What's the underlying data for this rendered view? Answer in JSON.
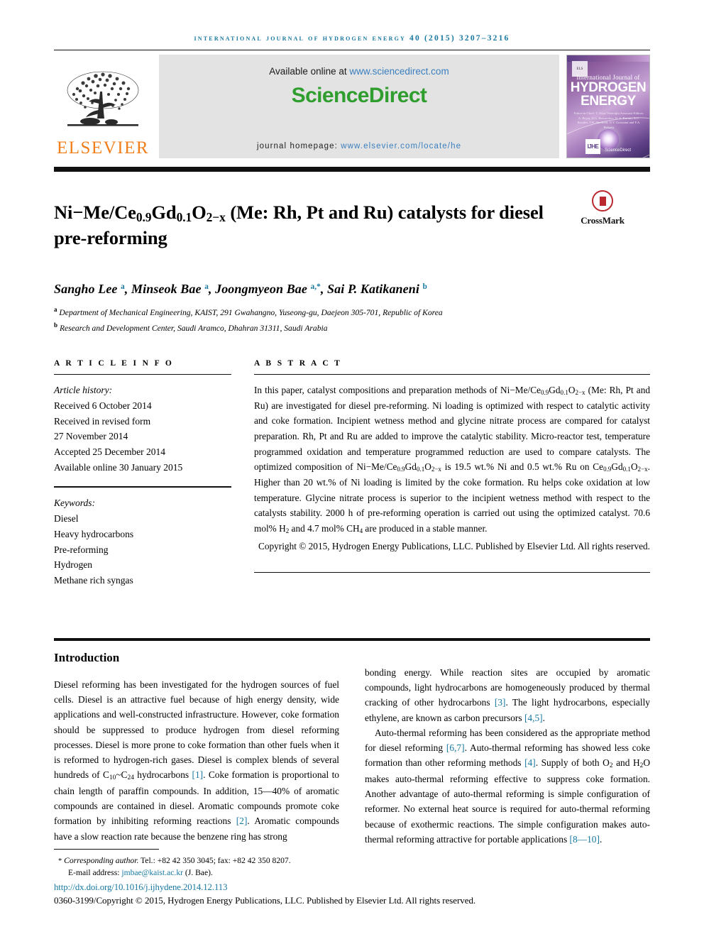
{
  "running_head": "International Journal of Hydrogen Energy 40 (2015) 3207–3216",
  "masthead": {
    "publisher": "ELSEVIER",
    "available_prefix": "Available online at ",
    "available_url": "www.sciencedirect.com",
    "sciencedirect_science": "Science",
    "sciencedirect_direct": "Direct",
    "homepage_prefix": "journal homepage: ",
    "homepage_url": "www.elsevier.com/locate/he",
    "cover": {
      "elsevier_mark": "ELSEVIER",
      "subtitle": "International Journal of",
      "title_line1": "HYDROGEN",
      "title_line2": "ENERGY",
      "editors": "Editor-in-Chief: T. Nejat Veziroğlu\nAssociate Editors: A. Bejan, D.G. Bessarabov, N. A. Kurum, A.C. Rosales, J.W. Sheffield, D.Y. Goswami and F.A. Peñuela",
      "ijhe_mark": "IJHE",
      "sciencedirect_mark": "ScienceDirect"
    }
  },
  "article": {
    "title_html": "Ni−Me/Ce<sub>0.9</sub>Gd<sub>0.1</sub>O<sub>2−x</sub> (Me: Rh, Pt and Ru) catalysts for diesel pre-reforming",
    "crossmark_label": "CrossMark",
    "authors_html": "Sangho Lee <sup>a</sup>, Minseok Bae <sup>a</sup>, Joongmyeon Bae <sup>a,*</sup>, Sai P. Katikaneni <sup>b</sup>",
    "affiliations": [
      {
        "marker": "a",
        "text": "Department of Mechanical Engineering, KAIST, 291 Gwahangno, Yuseong-gu, Daejeon 305-701, Republic of Korea"
      },
      {
        "marker": "b",
        "text": "Research and Development Center, Saudi Aramco, Dhahran 31311, Saudi Arabia"
      }
    ]
  },
  "article_info": {
    "heading": "A R T I C L E   I N F O",
    "history_label": "Article history:",
    "history": [
      "Received 6 October 2014",
      "Received in revised form",
      "27 November 2014",
      "Accepted 25 December 2014",
      "Available online 30 January 2015"
    ],
    "keywords_label": "Keywords:",
    "keywords": [
      "Diesel",
      "Heavy hydrocarbons",
      "Pre-reforming",
      "Hydrogen",
      "Methane rich syngas"
    ]
  },
  "abstract": {
    "heading": "A B S T R A C T",
    "body_html": "In this paper, catalyst compositions and preparation methods of Ni−Me/Ce<sub>0.9</sub>Gd<sub>0.1</sub>O<sub>2−x</sub> (Me: Rh, Pt and Ru) are investigated for diesel pre-reforming. Ni loading is optimized with respect to catalytic activity and coke formation. Incipient wetness method and glycine nitrate process are compared for catalyst preparation. Rh, Pt and Ru are added to improve the catalytic stability. Micro-reactor test, temperature programmed oxidation and temperature programmed reduction are used to compare catalysts. The optimized composition of Ni−Me/Ce<sub>0.9</sub>Gd<sub>0.1</sub>O<sub>2−x</sub> is 19.5 wt.% Ni and 0.5 wt.% Ru on Ce<sub>0.9</sub>Gd<sub>0.1</sub>O<sub>2−x</sub>. Higher than 20 wt.% of Ni loading is limited by the coke formation. Ru helps coke oxidation at low temperature. Glycine nitrate process is superior to the incipient wetness method with respect to the catalysts stability. 2000 h of pre-reforming operation is carried out using the optimized catalyst. 70.6 mol% H<sub>2</sub> and 4.7 mol% CH<sub>4</sub> are produced in a stable manner.",
    "copyright": "Copyright © 2015, Hydrogen Energy Publications, LLC. Published by Elsevier Ltd. All rights reserved."
  },
  "introduction": {
    "heading": "Introduction",
    "left_paragraph_html": "Diesel reforming has been investigated for the hydrogen sources of fuel cells. Diesel is an attractive fuel because of high energy density, wide applications and well-constructed infrastructure. However, coke formation should be suppressed to produce hydrogen from diesel reforming processes. Diesel is more prone to coke formation than other fuels when it is reformed to hydrogen-rich gases. Diesel is complex blends of several hundreds of C<sub>10</sub>~C<sub>24</sub> hydrocarbons <span class=\"cite\">[1]</span>. Coke formation is proportional to chain length of paraffin compounds. In addition, 15—40% of aromatic compounds are contained in diesel. Aromatic compounds promote coke formation by inhibiting reforming reactions <span class=\"cite\">[2]</span>. Aromatic compounds have a slow reaction rate because the benzene ring has strong",
    "right_paragraph_1_html": "bonding energy. While reaction sites are occupied by aromatic compounds, light hydrocarbons are homogeneously produced by thermal cracking of other hydrocarbons <span class=\"cite\">[3]</span>. The light hydrocarbons, especially ethylene, are known as carbon precursors <span class=\"cite\">[4,5]</span>.",
    "right_paragraph_2_html": "Auto-thermal reforming has been considered as the appropriate method for diesel reforming <span class=\"cite\">[6,7]</span>. Auto-thermal reforming has showed less coke formation than other reforming methods <span class=\"cite\">[4]</span>. Supply of both O<sub>2</sub> and H<sub>2</sub>O makes auto-thermal reforming effective to suppress coke formation. Another advantage of auto-thermal reforming is simple configuration of reformer. No external heat source is required for auto-thermal reforming because of exothermic reactions. The simple configuration makes auto-thermal reforming attractive for portable applications <span class=\"cite\">[8—10]</span>."
  },
  "footer": {
    "corresponding_html": "<span class=\"star\">*</span> <i>Corresponding author.</i> Tel.: +82 42 350 3045; fax: +82 42 350 8207.",
    "email_label": "E-mail address: ",
    "email": "jmbae@kaist.ac.kr",
    "email_suffix": " (J. Bae).",
    "doi": "http://dx.doi.org/10.1016/j.ijhydene.2014.12.113",
    "issn_copyright": "0360-3199/Copyright © 2015, Hydrogen Energy Publications, LLC. Published by Elsevier Ltd. All rights reserved."
  },
  "colors": {
    "header_blue": "#1878a0",
    "link_blue": "#3a7fbf",
    "elsevier_orange": "#f07f19",
    "sciencedirect_green": "#2f9e2f",
    "crossmark_red": "#b9292f"
  }
}
